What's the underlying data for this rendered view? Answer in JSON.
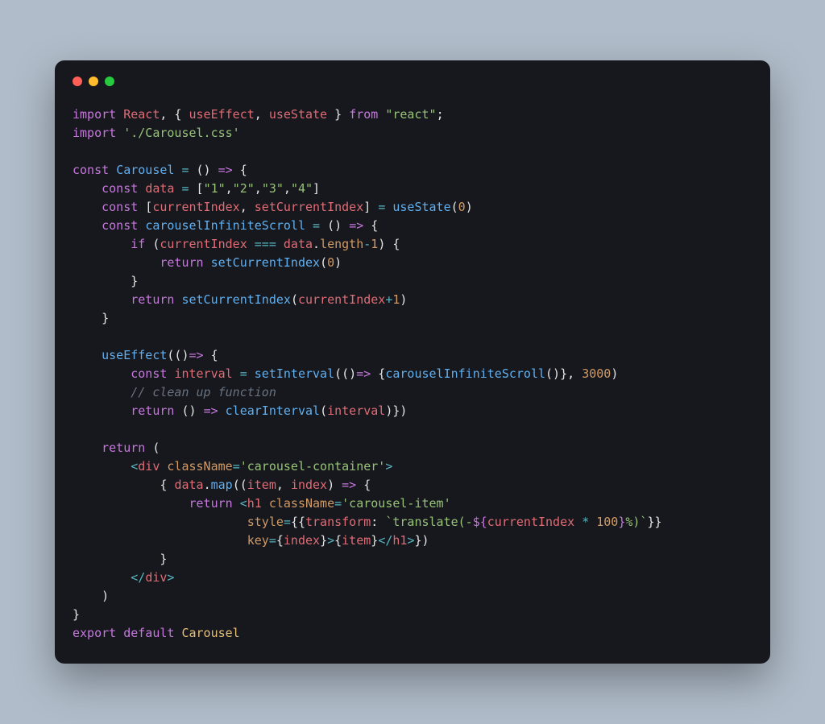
{
  "window": {
    "dots": [
      "close",
      "minimize",
      "zoom"
    ]
  },
  "code": {
    "lines": [
      [
        {
          "cls": "c-keyword",
          "t": "import"
        },
        {
          "cls": "",
          "t": " "
        },
        {
          "cls": "c-default",
          "t": "React"
        },
        {
          "cls": "",
          "t": ", { "
        },
        {
          "cls": "c-var",
          "t": "useEffect"
        },
        {
          "cls": "",
          "t": ", "
        },
        {
          "cls": "c-var",
          "t": "useState"
        },
        {
          "cls": "",
          "t": " } "
        },
        {
          "cls": "c-keyword",
          "t": "from"
        },
        {
          "cls": "",
          "t": " "
        },
        {
          "cls": "c-string",
          "t": "\"react\""
        },
        {
          "cls": "",
          "t": ";"
        }
      ],
      [
        {
          "cls": "c-keyword",
          "t": "import"
        },
        {
          "cls": "",
          "t": " "
        },
        {
          "cls": "c-string",
          "t": "'./Carousel.css'"
        }
      ],
      [
        {
          "cls": "",
          "t": ""
        }
      ],
      [
        {
          "cls": "c-keyword",
          "t": "const"
        },
        {
          "cls": "",
          "t": " "
        },
        {
          "cls": "c-fn",
          "t": "Carousel"
        },
        {
          "cls": "",
          "t": " "
        },
        {
          "cls": "c-op",
          "t": "="
        },
        {
          "cls": "",
          "t": " () "
        },
        {
          "cls": "c-keyword",
          "t": "=>"
        },
        {
          "cls": "",
          "t": " {"
        }
      ],
      [
        {
          "cls": "",
          "t": "    "
        },
        {
          "cls": "c-keyword",
          "t": "const"
        },
        {
          "cls": "",
          "t": " "
        },
        {
          "cls": "c-var",
          "t": "data"
        },
        {
          "cls": "",
          "t": " "
        },
        {
          "cls": "c-op",
          "t": "="
        },
        {
          "cls": "",
          "t": " ["
        },
        {
          "cls": "c-string",
          "t": "\"1\""
        },
        {
          "cls": "",
          "t": ","
        },
        {
          "cls": "c-string",
          "t": "\"2\""
        },
        {
          "cls": "",
          "t": ","
        },
        {
          "cls": "c-string",
          "t": "\"3\""
        },
        {
          "cls": "",
          "t": ","
        },
        {
          "cls": "c-string",
          "t": "\"4\""
        },
        {
          "cls": "",
          "t": "]"
        }
      ],
      [
        {
          "cls": "",
          "t": "    "
        },
        {
          "cls": "c-keyword",
          "t": "const"
        },
        {
          "cls": "",
          "t": " ["
        },
        {
          "cls": "c-var",
          "t": "currentIndex"
        },
        {
          "cls": "",
          "t": ", "
        },
        {
          "cls": "c-var",
          "t": "setCurrentIndex"
        },
        {
          "cls": "",
          "t": "] "
        },
        {
          "cls": "c-op",
          "t": "="
        },
        {
          "cls": "",
          "t": " "
        },
        {
          "cls": "c-fn",
          "t": "useState"
        },
        {
          "cls": "",
          "t": "("
        },
        {
          "cls": "c-num",
          "t": "0"
        },
        {
          "cls": "",
          "t": ")"
        }
      ],
      [
        {
          "cls": "",
          "t": "    "
        },
        {
          "cls": "c-keyword",
          "t": "const"
        },
        {
          "cls": "",
          "t": " "
        },
        {
          "cls": "c-fn",
          "t": "carouselInfiniteScroll"
        },
        {
          "cls": "",
          "t": " "
        },
        {
          "cls": "c-op",
          "t": "="
        },
        {
          "cls": "",
          "t": " () "
        },
        {
          "cls": "c-keyword",
          "t": "=>"
        },
        {
          "cls": "",
          "t": " {"
        }
      ],
      [
        {
          "cls": "",
          "t": "        "
        },
        {
          "cls": "c-keyword",
          "t": "if"
        },
        {
          "cls": "",
          "t": " ("
        },
        {
          "cls": "c-var",
          "t": "currentIndex"
        },
        {
          "cls": "",
          "t": " "
        },
        {
          "cls": "c-op",
          "t": "==="
        },
        {
          "cls": "",
          "t": " "
        },
        {
          "cls": "c-var",
          "t": "data"
        },
        {
          "cls": "",
          "t": "."
        },
        {
          "cls": "c-prop",
          "t": "length"
        },
        {
          "cls": "c-op",
          "t": "-"
        },
        {
          "cls": "c-num",
          "t": "1"
        },
        {
          "cls": "",
          "t": ") {"
        }
      ],
      [
        {
          "cls": "",
          "t": "            "
        },
        {
          "cls": "c-keyword",
          "t": "return"
        },
        {
          "cls": "",
          "t": " "
        },
        {
          "cls": "c-fn",
          "t": "setCurrentIndex"
        },
        {
          "cls": "",
          "t": "("
        },
        {
          "cls": "c-num",
          "t": "0"
        },
        {
          "cls": "",
          "t": ")"
        }
      ],
      [
        {
          "cls": "",
          "t": "        }"
        }
      ],
      [
        {
          "cls": "",
          "t": "        "
        },
        {
          "cls": "c-keyword",
          "t": "return"
        },
        {
          "cls": "",
          "t": " "
        },
        {
          "cls": "c-fn",
          "t": "setCurrentIndex"
        },
        {
          "cls": "",
          "t": "("
        },
        {
          "cls": "c-var",
          "t": "currentIndex"
        },
        {
          "cls": "c-op",
          "t": "+"
        },
        {
          "cls": "c-num",
          "t": "1"
        },
        {
          "cls": "",
          "t": ")"
        }
      ],
      [
        {
          "cls": "",
          "t": "    }"
        }
      ],
      [
        {
          "cls": "",
          "t": ""
        }
      ],
      [
        {
          "cls": "",
          "t": "    "
        },
        {
          "cls": "c-fn",
          "t": "useEffect"
        },
        {
          "cls": "",
          "t": "(()"
        },
        {
          "cls": "c-keyword",
          "t": "=>"
        },
        {
          "cls": "",
          "t": " {"
        }
      ],
      [
        {
          "cls": "",
          "t": "        "
        },
        {
          "cls": "c-keyword",
          "t": "const"
        },
        {
          "cls": "",
          "t": " "
        },
        {
          "cls": "c-var",
          "t": "interval"
        },
        {
          "cls": "",
          "t": " "
        },
        {
          "cls": "c-op",
          "t": "="
        },
        {
          "cls": "",
          "t": " "
        },
        {
          "cls": "c-fn",
          "t": "setInterval"
        },
        {
          "cls": "",
          "t": "(()"
        },
        {
          "cls": "c-keyword",
          "t": "=>"
        },
        {
          "cls": "",
          "t": " {"
        },
        {
          "cls": "c-fn",
          "t": "carouselInfiniteScroll"
        },
        {
          "cls": "",
          "t": "()}, "
        },
        {
          "cls": "c-num",
          "t": "3000"
        },
        {
          "cls": "",
          "t": ")"
        }
      ],
      [
        {
          "cls": "",
          "t": "        "
        },
        {
          "cls": "c-comment",
          "t": "// clean up function"
        }
      ],
      [
        {
          "cls": "",
          "t": "        "
        },
        {
          "cls": "c-keyword",
          "t": "return"
        },
        {
          "cls": "",
          "t": " () "
        },
        {
          "cls": "c-keyword",
          "t": "=>"
        },
        {
          "cls": "",
          "t": " "
        },
        {
          "cls": "c-fn",
          "t": "clearInterval"
        },
        {
          "cls": "",
          "t": "("
        },
        {
          "cls": "c-var",
          "t": "interval"
        },
        {
          "cls": "",
          "t": ")})"
        }
      ],
      [
        {
          "cls": "",
          "t": ""
        }
      ],
      [
        {
          "cls": "",
          "t": "    "
        },
        {
          "cls": "c-keyword",
          "t": "return"
        },
        {
          "cls": "",
          "t": " ("
        }
      ],
      [
        {
          "cls": "",
          "t": "        "
        },
        {
          "cls": "c-op",
          "t": "<"
        },
        {
          "cls": "c-tag",
          "t": "div"
        },
        {
          "cls": "",
          "t": " "
        },
        {
          "cls": "c-attr",
          "t": "className"
        },
        {
          "cls": "c-op",
          "t": "="
        },
        {
          "cls": "c-string",
          "t": "'carousel-container'"
        },
        {
          "cls": "c-op",
          "t": ">"
        }
      ],
      [
        {
          "cls": "",
          "t": "            { "
        },
        {
          "cls": "c-var",
          "t": "data"
        },
        {
          "cls": "",
          "t": "."
        },
        {
          "cls": "c-fn",
          "t": "map"
        },
        {
          "cls": "",
          "t": "(("
        },
        {
          "cls": "c-var",
          "t": "item"
        },
        {
          "cls": "",
          "t": ", "
        },
        {
          "cls": "c-var",
          "t": "index"
        },
        {
          "cls": "",
          "t": ") "
        },
        {
          "cls": "c-keyword",
          "t": "=>"
        },
        {
          "cls": "",
          "t": " {"
        }
      ],
      [
        {
          "cls": "",
          "t": "                "
        },
        {
          "cls": "c-keyword",
          "t": "return"
        },
        {
          "cls": "",
          "t": " "
        },
        {
          "cls": "c-op",
          "t": "<"
        },
        {
          "cls": "c-tag",
          "t": "h1"
        },
        {
          "cls": "",
          "t": " "
        },
        {
          "cls": "c-attr",
          "t": "className"
        },
        {
          "cls": "c-op",
          "t": "="
        },
        {
          "cls": "c-string",
          "t": "'carousel-item'"
        }
      ],
      [
        {
          "cls": "",
          "t": "                        "
        },
        {
          "cls": "c-attr",
          "t": "style"
        },
        {
          "cls": "c-op",
          "t": "="
        },
        {
          "cls": "",
          "t": "{{"
        },
        {
          "cls": "c-var",
          "t": "transform"
        },
        {
          "cls": "",
          "t": ": "
        },
        {
          "cls": "c-string",
          "t": "`translate(-"
        },
        {
          "cls": "c-keyword",
          "t": "${"
        },
        {
          "cls": "c-var",
          "t": "currentIndex"
        },
        {
          "cls": "",
          "t": " "
        },
        {
          "cls": "c-op",
          "t": "*"
        },
        {
          "cls": "",
          "t": " "
        },
        {
          "cls": "c-num",
          "t": "100"
        },
        {
          "cls": "c-keyword",
          "t": "}"
        },
        {
          "cls": "c-string",
          "t": "%)`"
        },
        {
          "cls": "",
          "t": "}}"
        }
      ],
      [
        {
          "cls": "",
          "t": "                        "
        },
        {
          "cls": "c-attr",
          "t": "key"
        },
        {
          "cls": "c-op",
          "t": "="
        },
        {
          "cls": "",
          "t": "{"
        },
        {
          "cls": "c-var",
          "t": "index"
        },
        {
          "cls": "",
          "t": "}"
        },
        {
          "cls": "c-op",
          "t": ">"
        },
        {
          "cls": "",
          "t": "{"
        },
        {
          "cls": "c-var",
          "t": "item"
        },
        {
          "cls": "",
          "t": "}"
        },
        {
          "cls": "c-op",
          "t": "</"
        },
        {
          "cls": "c-tag",
          "t": "h1"
        },
        {
          "cls": "c-op",
          "t": ">"
        },
        {
          "cls": "",
          "t": "})"
        }
      ],
      [
        {
          "cls": "",
          "t": "            }"
        }
      ],
      [
        {
          "cls": "",
          "t": "        "
        },
        {
          "cls": "c-op",
          "t": "</"
        },
        {
          "cls": "c-tag",
          "t": "div"
        },
        {
          "cls": "c-op",
          "t": ">"
        }
      ],
      [
        {
          "cls": "",
          "t": "    )"
        }
      ],
      [
        {
          "cls": "",
          "t": "}"
        }
      ],
      [
        {
          "cls": "c-keyword",
          "t": "export"
        },
        {
          "cls": "",
          "t": " "
        },
        {
          "cls": "c-keyword",
          "t": "default"
        },
        {
          "cls": "",
          "t": " "
        },
        {
          "cls": "c-yellow",
          "t": "Carousel"
        }
      ]
    ]
  }
}
